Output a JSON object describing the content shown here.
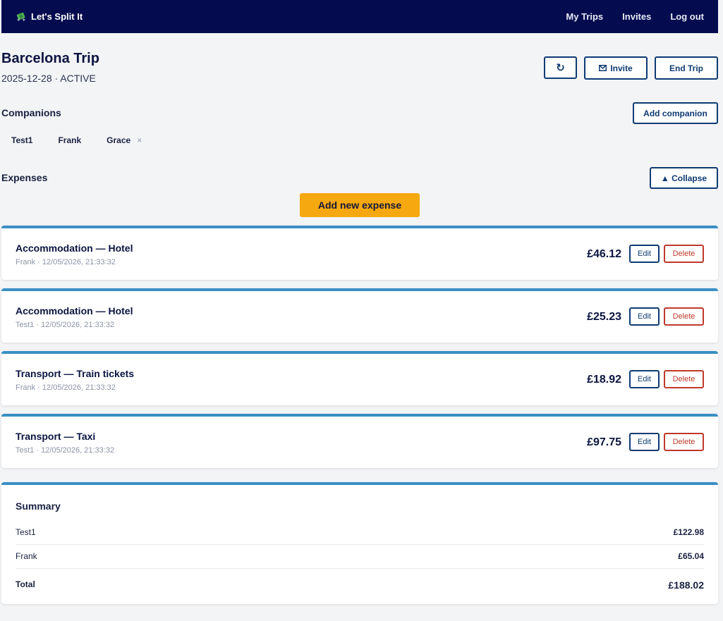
{
  "nav": {
    "brand": "Let's Split It",
    "links": [
      "My Trips",
      "Invites",
      "Log out"
    ]
  },
  "trip": {
    "title": "Barcelona Trip",
    "meta": "2025-12-28 · ACTIVE"
  },
  "actions": {
    "refresh_icon": "↻",
    "invite_label": "Invite",
    "end_label": "End Trip"
  },
  "companions": {
    "title": "Companions",
    "add_label": "Add companion",
    "list": [
      "Test1",
      "Frank",
      "Grace"
    ],
    "remove_glyph": "×"
  },
  "expenses": {
    "title": "Expenses",
    "collapse_label": "▲ Collapse",
    "add_label": "Add new expense",
    "edit_label": "Edit",
    "delete_label": "Delete",
    "items": [
      {
        "title": "Accommodation — Hotel",
        "payer": "Frank",
        "timestamp": "12/05/2026, 21:33:32",
        "amount": "£46.12"
      },
      {
        "title": "Accommodation — Hotel",
        "payer": "Test1",
        "timestamp": "12/05/2026, 21:33:32",
        "amount": "£25.23"
      },
      {
        "title": "Transport — Train tickets",
        "payer": "Frank",
        "timestamp": "12/05/2026, 21:33:32",
        "amount": "£18.92"
      },
      {
        "title": "Transport — Taxi",
        "payer": "Test1",
        "timestamp": "12/05/2026, 21:33:32",
        "amount": "£97.75"
      }
    ]
  },
  "summary": {
    "title": "Summary",
    "rows": [
      {
        "name": "Test1",
        "amount": "£122.98"
      },
      {
        "name": "Frank",
        "amount": "£65.04"
      }
    ],
    "total_label": "Total",
    "total_amount": "£188.02"
  },
  "colors": {
    "nav_bg": "#040c4f",
    "accent_bar": "#3a8fc4",
    "primary_outline": "#0e3b73",
    "danger": "#c0392b",
    "cta": "#f5a80f"
  }
}
